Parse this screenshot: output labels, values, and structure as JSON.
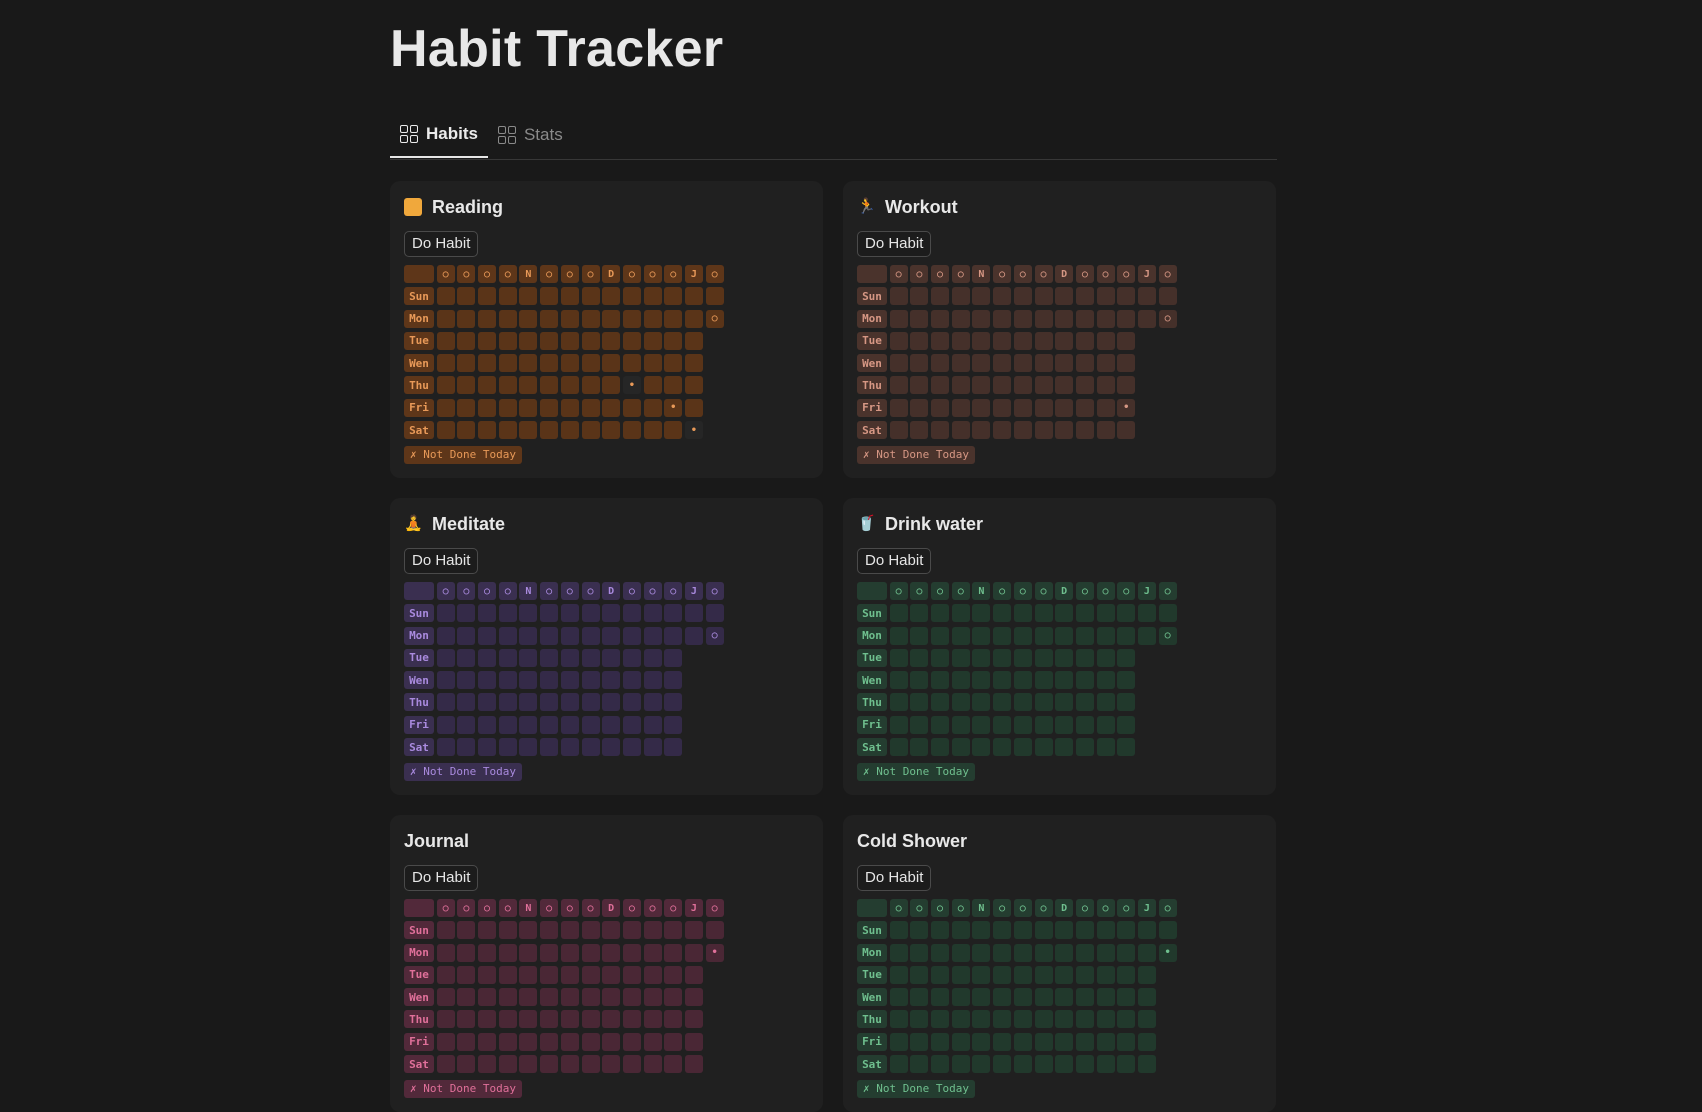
{
  "page": {
    "title": "Habit Tracker"
  },
  "tabs": [
    {
      "label": "Habits",
      "active": true
    },
    {
      "label": "Stats",
      "active": false
    }
  ],
  "labels": {
    "button": "Do Habit",
    "status": "✗ Not Done Today",
    "days": [
      "Sun",
      "Mon",
      "Tue",
      "Wen",
      "Thu",
      "Fri",
      "Sat"
    ],
    "header": [
      "○",
      "○",
      "○",
      "○",
      "N",
      "○",
      "○",
      "○",
      "D",
      "○",
      "○",
      "○",
      "J",
      "○"
    ]
  },
  "habits": [
    {
      "name": "Reading",
      "icon": "book-icon",
      "glyph": "",
      "theme": {
        "cell": "#5a3418",
        "label": "#5e3619",
        "text": "#e89958"
      },
      "today_row": 5,
      "today_col": 9,
      "last_week_len": 14
    },
    {
      "name": "Workout",
      "icon": "runner-icon",
      "glyph": "🏃",
      "theme": {
        "cell": "#45302a",
        "label": "#4a332c",
        "text": "#d69784"
      },
      "today_row": 5,
      "today_col": 13,
      "last_week_len": 13
    },
    {
      "name": "Meditate",
      "icon": "meditation-icon",
      "glyph": "🧘",
      "theme": {
        "cell": "#342a48",
        "label": "#3a2f50",
        "text": "#a98ade"
      },
      "today_row": 6,
      "today_col": 13,
      "last_week_len": 13
    },
    {
      "name": "Drink water",
      "icon": "cup-icon",
      "glyph": "🥤",
      "theme": {
        "cell": "#21392c",
        "label": "#243d30",
        "text": "#6fbf8e"
      },
      "today_row": 6,
      "today_col": 13,
      "last_week_len": 13
    },
    {
      "name": "Journal",
      "icon": "",
      "glyph": "",
      "theme": {
        "cell": "#4a2735",
        "label": "#52293a",
        "text": "#e0709a"
      },
      "today_row": 1,
      "today_col": 14,
      "last_week_len": 14
    },
    {
      "name": "Cold Shower",
      "icon": "",
      "glyph": "",
      "theme": {
        "cell": "#21392c",
        "label": "#243d30",
        "text": "#6fbf8e"
      },
      "today_row": 1,
      "today_col": 14,
      "last_week_len": 14
    }
  ]
}
